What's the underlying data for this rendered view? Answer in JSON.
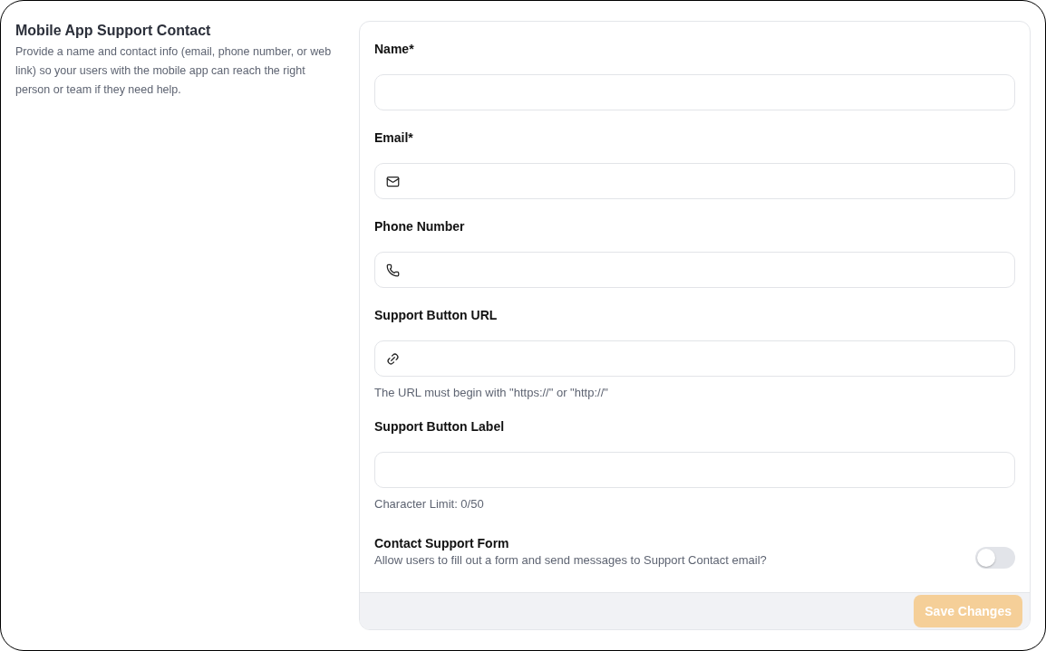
{
  "section": {
    "title": "Mobile App Support Contact",
    "description": "Provide a name and contact info (email, phone number, or web link) so your users with the mobile app can reach the right person or team if they need help."
  },
  "fields": [
    {
      "label": "Name*",
      "kind": "text"
    },
    {
      "label": "Email*",
      "kind": "email"
    },
    {
      "label": "Phone Number",
      "kind": "phone"
    },
    {
      "label": "Support Button URL",
      "kind": "url",
      "helper": "The URL must begin with \"https://\" or \"http://\""
    },
    {
      "label": "Support Button Label",
      "kind": "text",
      "helper": "Character Limit: 0/50"
    }
  ],
  "toggle": {
    "label": "Contact Support Form",
    "description": "Allow users to fill out a form and send messages to Support Contact email?",
    "on": false
  },
  "save_button": {
    "label": "Save Changes",
    "disabled": true
  }
}
